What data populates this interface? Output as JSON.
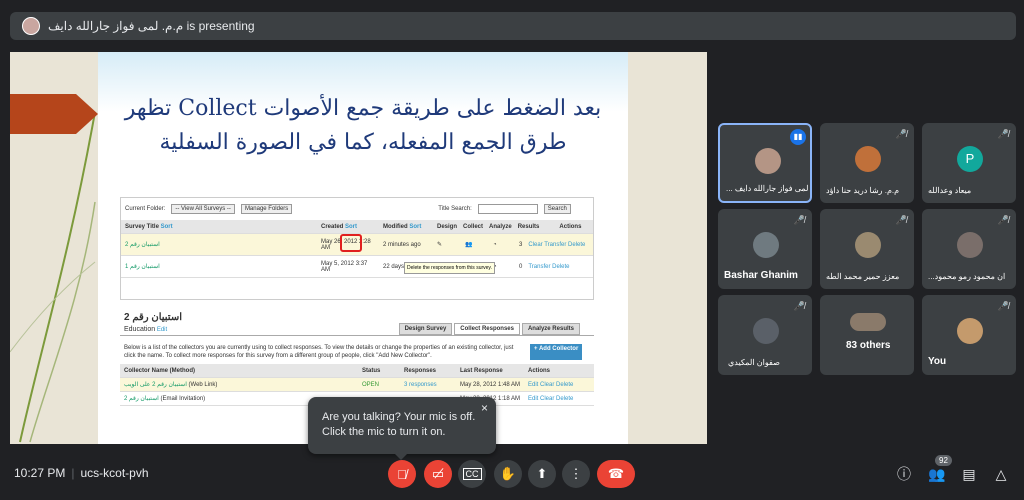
{
  "banner": {
    "text": "م.م. لمى فواز جارالله دايف is presenting"
  },
  "slide": {
    "title": "بعد الضغط على طريقة جمع الأصوات Collect تظهر طرق الجمع المفعله، كما في الصورة السفلية",
    "toolbar": {
      "folder_label": "Current Folder:",
      "folder_value": "-- View All Surveys --",
      "manage": "Manage Folders",
      "search_label": "Title Search:",
      "search_btn": "Search"
    },
    "headers": {
      "title": "Survey Title",
      "sort": "Sort",
      "created": "Created",
      "modified": "Modified",
      "design": "Design",
      "collect": "Collect",
      "analyze": "Analyze",
      "results": "Results",
      "actions": "Actions"
    },
    "rows": [
      {
        "title": "استبيان رقم 2",
        "created": "May 26, 2012 2:28 AM",
        "modified": "2 minutes ago",
        "count": "3",
        "actions": "Clear  Transfer  Delete"
      },
      {
        "title": "استبيان رقم 1",
        "created": "May 5, 2012 3:37 AM",
        "modified": "22 days ago",
        "count": "0",
        "actions": "Transfer  Delete"
      }
    ],
    "tooltip": "Delete the responses from this survey.",
    "survey_name": "استبيان رقم 2",
    "category": "Education",
    "edit": "Edit",
    "tabs": [
      "Design Survey",
      "Collect Responses",
      "Analyze Results"
    ],
    "desc": "Below is a list of the collectors you are currently using to collect responses. To view the details or change the properties of an existing collector, just click the name. To collect more responses for this survey from a different group of people, click \"Add New Collector\".",
    "add_collector": "+ Add Collector",
    "col_headers": {
      "name": "Collector Name (Method)",
      "status": "Status",
      "responses": "Responses",
      "last": "Last Response",
      "actions": "Actions"
    },
    "collectors": [
      {
        "name": "استبيان رقم 2 على الويب",
        "method": "(Web Link)",
        "status": "OPEN",
        "responses": "3 responses",
        "last": "May 28, 2012 1:48 AM",
        "actions": "Edit  Clear  Delete"
      },
      {
        "name": "استبيان رقم 2",
        "method": "(Email Invitation)",
        "status": "",
        "responses": "",
        "last": "May 28, 2012 1:18 AM",
        "actions": "Edit  Clear  Delete"
      }
    ]
  },
  "toast": {
    "line1": "Are you talking? Your mic is off.",
    "line2": "Click the mic to turn it on.",
    "close": "×"
  },
  "participants": [
    {
      "name": "... لمى فواز جارالله دايف"
    },
    {
      "name": "م.م. رشا دريد حنا داؤد"
    },
    {
      "name": "ميعاد وعدالله",
      "initial": "P"
    },
    {
      "name": "Bashar Ghanim"
    },
    {
      "name": "معزز حمير محمد الطه"
    },
    {
      "name": "...ان محمود رمو محمود"
    },
    {
      "name": "صفوان المكيدي"
    },
    {
      "name": "83 others"
    },
    {
      "name": "You"
    }
  ],
  "footer": {
    "time": "10:27 PM",
    "code": "ucs-kcot-pvh",
    "people_count": "92"
  },
  "colors": {
    "accent": "#8ab4f8",
    "danger": "#ea4335",
    "panel": "#3c4043",
    "bg": "#202124"
  }
}
